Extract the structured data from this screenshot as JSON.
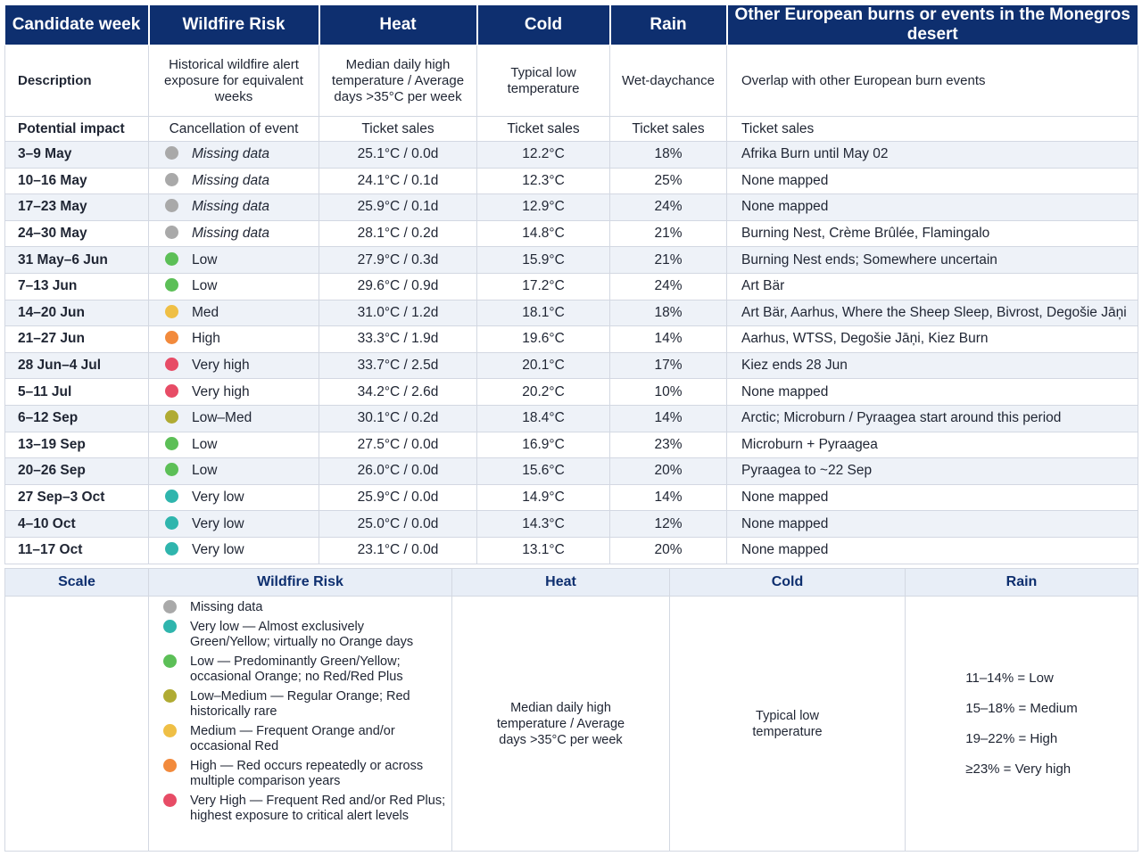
{
  "header": {
    "week": "Candidate week",
    "wildfire": "Wildfire Risk",
    "heat": "Heat",
    "cold": "Cold",
    "rain": "Rain",
    "other": "Other European burns or events in the Monegros desert"
  },
  "description": {
    "label": "Description",
    "wildfire": "Historical wildfire alert exposure for equivalent weeks",
    "heat": "Median daily high temperature / Average days >35°C per week",
    "cold": "Typical low temperature",
    "rain": "Wet-daychance",
    "other": "Overlap with other European burn events"
  },
  "impact": {
    "label": "Potential impact",
    "wildfire": "Cancellation of event",
    "heat": "Ticket sales",
    "cold": "Ticket sales",
    "rain": "Ticket sales",
    "other": "Ticket sales"
  },
  "colors": {
    "header_bg": "#0e2f6f",
    "missing": "#a9a9a9",
    "very_low": "#2fb5ad",
    "low": "#5cbf57",
    "low_med": "#b0ab33",
    "med": "#efbf45",
    "high": "#f28a3c",
    "very_high": "#e74c66"
  },
  "rows": [
    {
      "week": "3–9 May",
      "risk": "Missing data",
      "risk_color": "#a9a9a9",
      "heat": "25.1°C / 0.0d",
      "cold": "12.2°C",
      "rain": "18%",
      "other": "Afrika Burn until May 02"
    },
    {
      "week": "10–16 May",
      "risk": "Missing data",
      "risk_color": "#a9a9a9",
      "heat": "24.1°C / 0.1d",
      "cold": "12.3°C",
      "rain": "25%",
      "other": "None mapped"
    },
    {
      "week": "17–23 May",
      "risk": "Missing data",
      "risk_color": "#a9a9a9",
      "heat": "25.9°C / 0.1d",
      "cold": "12.9°C",
      "rain": "24%",
      "other": "None mapped"
    },
    {
      "week": "24–30 May",
      "risk": "Missing data",
      "risk_color": "#a9a9a9",
      "heat": "28.1°C / 0.2d",
      "cold": "14.8°C",
      "rain": "21%",
      "other": "Burning Nest, Crème Brûlée, Flamingalo"
    },
    {
      "week": "31 May–6 Jun",
      "risk": "Low",
      "risk_color": "#5cbf57",
      "heat": "27.9°C / 0.3d",
      "cold": "15.9°C",
      "rain": "21%",
      "other": "Burning Nest ends; Somewhere uncertain"
    },
    {
      "week": "7–13 Jun",
      "risk": "Low",
      "risk_color": "#5cbf57",
      "heat": "29.6°C / 0.9d",
      "cold": "17.2°C",
      "rain": "24%",
      "other": "Art Bär"
    },
    {
      "week": "14–20 Jun",
      "risk": "Med",
      "risk_color": "#efbf45",
      "heat": "31.0°C / 1.2d",
      "cold": "18.1°C",
      "rain": "18%",
      "other": "Art Bär, Aarhus, Where the Sheep Sleep, Bivrost, Degošie Jāņi"
    },
    {
      "week": "21–27 Jun",
      "risk": "High",
      "risk_color": "#f28a3c",
      "heat": "33.3°C / 1.9d",
      "cold": "19.6°C",
      "rain": "14%",
      "other": "Aarhus, WTSS, Degošie Jāņi, Kiez Burn"
    },
    {
      "week": "28 Jun–4 Jul",
      "risk": "Very high",
      "risk_color": "#e74c66",
      "heat": "33.7°C / 2.5d",
      "cold": "20.1°C",
      "rain": "17%",
      "other": "Kiez ends 28 Jun"
    },
    {
      "week": "5–11 Jul",
      "risk": "Very high",
      "risk_color": "#e74c66",
      "heat": "34.2°C / 2.6d",
      "cold": "20.2°C",
      "rain": "10%",
      "other": "None mapped"
    },
    {
      "week": "6–12 Sep",
      "risk": "Low–Med",
      "risk_color": "#b0ab33",
      "heat": "30.1°C / 0.2d",
      "cold": "18.4°C",
      "rain": "14%",
      "other": "Arctic; Microburn / Pyraagea start around this period"
    },
    {
      "week": "13–19 Sep",
      "risk": "Low",
      "risk_color": "#5cbf57",
      "heat": "27.5°C / 0.0d",
      "cold": "16.9°C",
      "rain": "23%",
      "other": "Microburn + Pyraagea"
    },
    {
      "week": "20–26 Sep",
      "risk": "Low",
      "risk_color": "#5cbf57",
      "heat": "26.0°C / 0.0d",
      "cold": "15.6°C",
      "rain": "20%",
      "other": "Pyraagea to ~22 Sep"
    },
    {
      "week": "27 Sep–3 Oct",
      "risk": "Very low",
      "risk_color": "#2fb5ad",
      "heat": "25.9°C / 0.0d",
      "cold": "14.9°C",
      "rain": "14%",
      "other": "None mapped"
    },
    {
      "week": "4–10 Oct",
      "risk": "Very low",
      "risk_color": "#2fb5ad",
      "heat": "25.0°C / 0.0d",
      "cold": "14.3°C",
      "rain": "12%",
      "other": "None mapped"
    },
    {
      "week": "11–17 Oct",
      "risk": "Very low",
      "risk_color": "#2fb5ad",
      "heat": "23.1°C / 0.0d",
      "cold": "13.1°C",
      "rain": "20%",
      "other": "None mapped"
    }
  ],
  "scale": {
    "header": {
      "scale": "Scale",
      "wildfire": "Wildfire Risk",
      "heat": "Heat",
      "cold": "Cold",
      "rain": "Rain"
    },
    "wildfire_legend": [
      {
        "color": "#a9a9a9",
        "text": "Missing data"
      },
      {
        "color": "#2fb5ad",
        "text": "Very low — Almost exclusively Green/Yellow; virtually no Orange days"
      },
      {
        "color": "#5cbf57",
        "text": "Low — Predominantly Green/Yellow; occasional Orange; no Red/Red Plus"
      },
      {
        "color": "#b0ab33",
        "text": "Low–Medium — Regular Orange; Red historically rare"
      },
      {
        "color": "#efbf45",
        "text": "Medium — Frequent Orange and/or occasional Red"
      },
      {
        "color": "#f28a3c",
        "text": "High — Red occurs repeatedly or across multiple comparison years"
      },
      {
        "color": "#e74c66",
        "text": "Very High — Frequent Red and/or Red Plus; highest exposure to critical alert levels"
      }
    ],
    "heat": "Median daily high temperature / Average days >35°C per week",
    "cold": "Typical low temperature",
    "rain": [
      "11–14% = Low",
      "15–18% = Medium",
      "19–22% = High",
      "≥23% = Very high"
    ]
  }
}
